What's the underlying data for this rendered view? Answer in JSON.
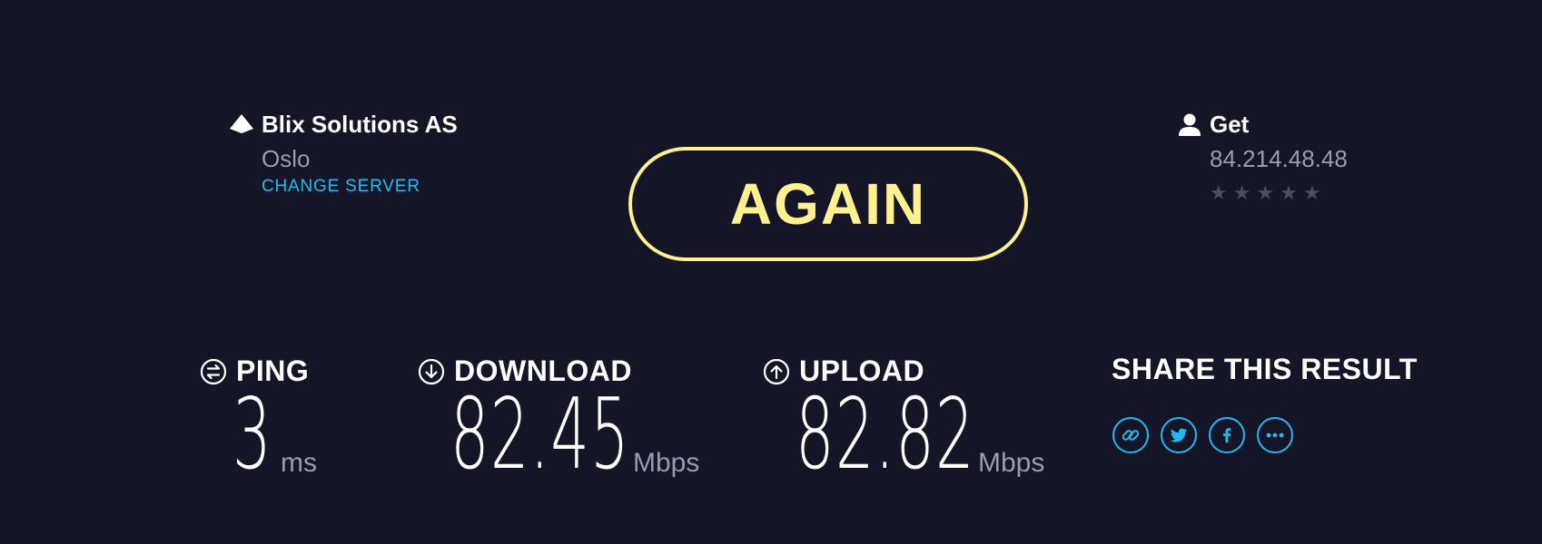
{
  "server": {
    "name": "Blix Solutions AS",
    "city": "Oslo",
    "change_label": "CHANGE SERVER",
    "icon": "server-icon"
  },
  "again": {
    "label": "AGAIN",
    "color": "#fff190"
  },
  "isp": {
    "name": "Get",
    "ip": "84.214.48.48",
    "icon": "user-icon",
    "rating": {
      "stars_total": 5,
      "stars_filled": 0
    }
  },
  "metrics": {
    "ping": {
      "label": "PING",
      "value": "3",
      "unit": "ms",
      "icon": "ping-icon"
    },
    "download": {
      "label": "DOWNLOAD",
      "value": "82.45",
      "unit": "Mbps",
      "icon": "download-arrow-icon"
    },
    "upload": {
      "label": "UPLOAD",
      "value": "82.82",
      "unit": "Mbps",
      "icon": "upload-arrow-icon"
    }
  },
  "share": {
    "title": "SHARE THIS RESULT",
    "icons": [
      "link-icon",
      "twitter-icon",
      "facebook-icon",
      "more-icon"
    ]
  },
  "colors": {
    "background": "#141526",
    "accent": "#22b9f2",
    "muted": "#9a9bb0",
    "star": "#4b4c60"
  }
}
